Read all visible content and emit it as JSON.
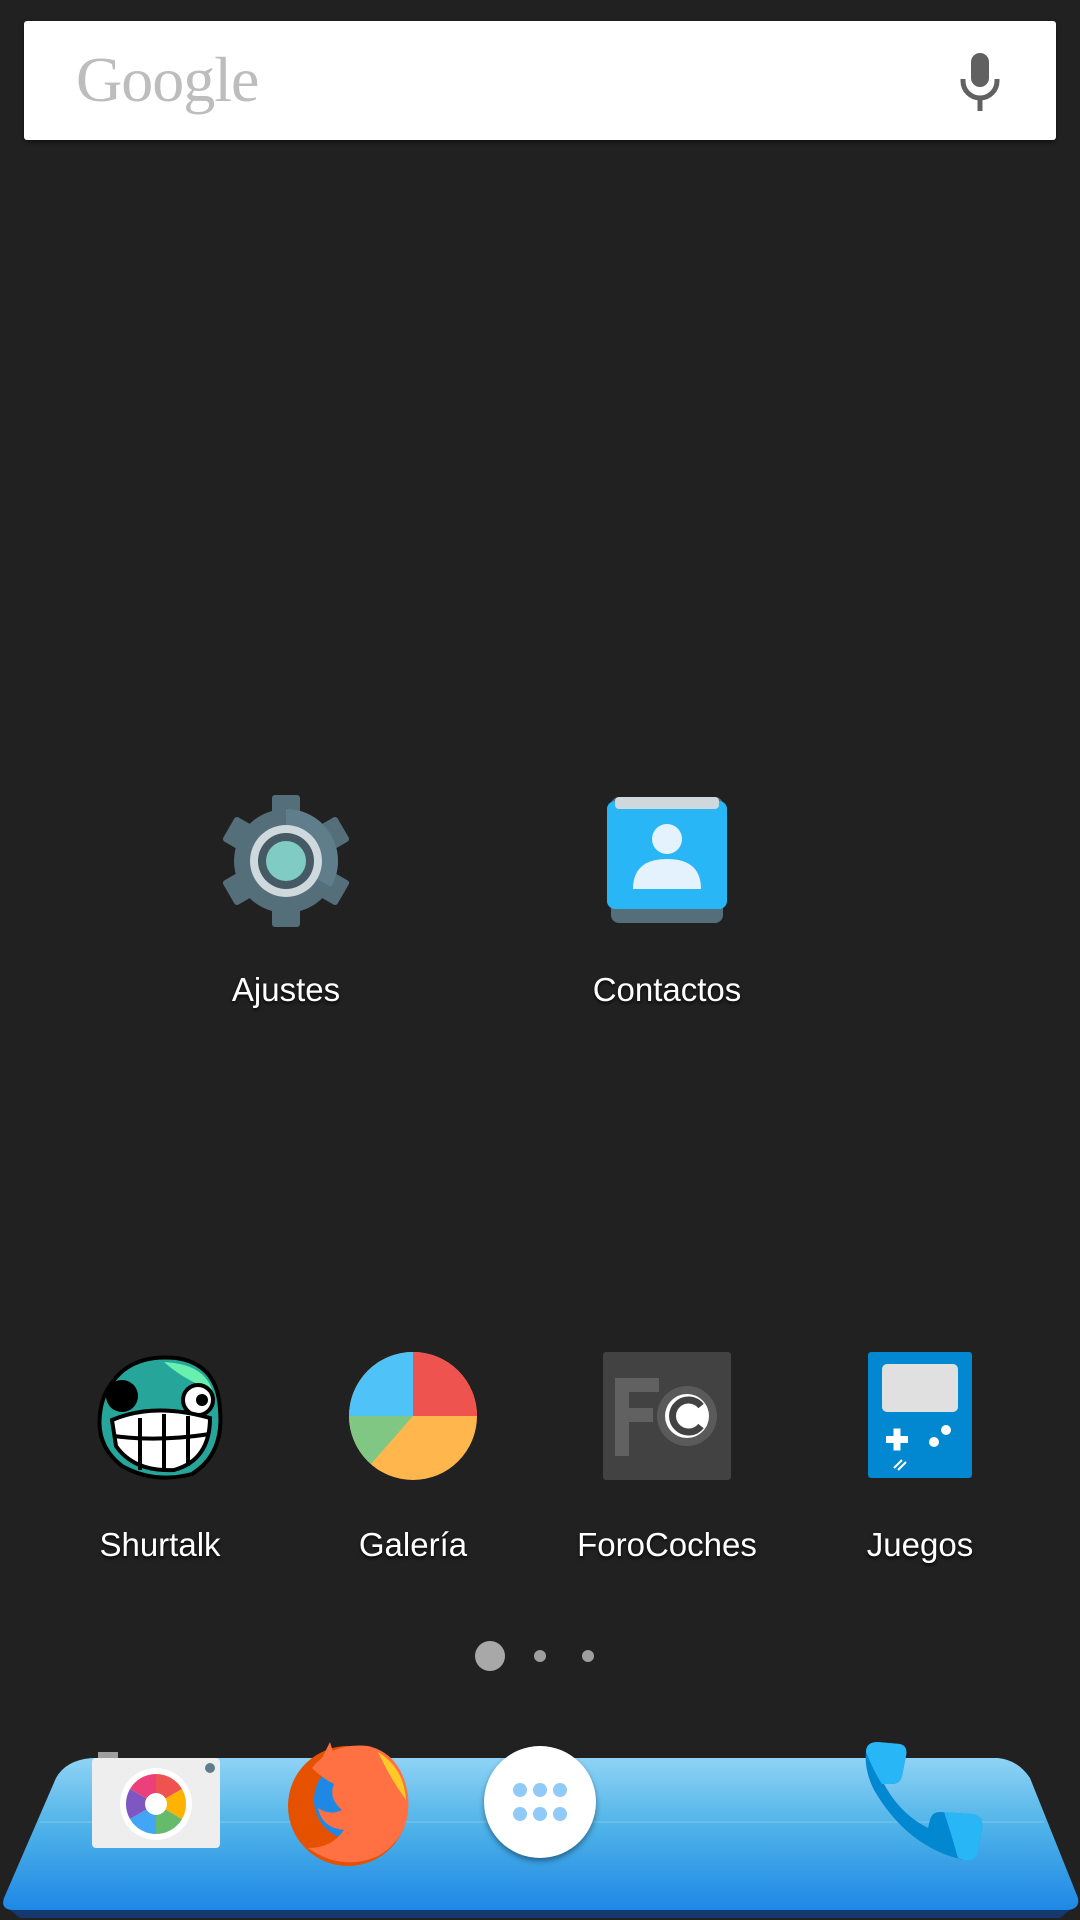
{
  "search": {
    "logo_text": "Google",
    "voice_icon": "mic-icon"
  },
  "apps_middle": [
    {
      "label": "Ajustes",
      "icon": "settings-gear-icon"
    },
    {
      "label": "Contactos",
      "icon": "contacts-icon"
    }
  ],
  "apps_bottom": [
    {
      "label": "Shurtalk",
      "icon": "shurtalk-troll-face-icon"
    },
    {
      "label": "Galería",
      "icon": "gallery-pie-icon"
    },
    {
      "label": "ForoCoches",
      "icon": "forocoches-fc-icon"
    },
    {
      "label": "Juegos",
      "icon": "gamepad-icon"
    }
  ],
  "page_indicator": {
    "pages": 3,
    "current": 1
  },
  "dock": {
    "items": [
      "camera-icon",
      "firefox-icon",
      "app-drawer-icon",
      "phone-icon"
    ],
    "colors": {
      "tray": "#4fb3e8",
      "tray_dark": "#1e88e5"
    }
  },
  "colors": {
    "background": "#212121",
    "label_text": "#ffffff"
  }
}
